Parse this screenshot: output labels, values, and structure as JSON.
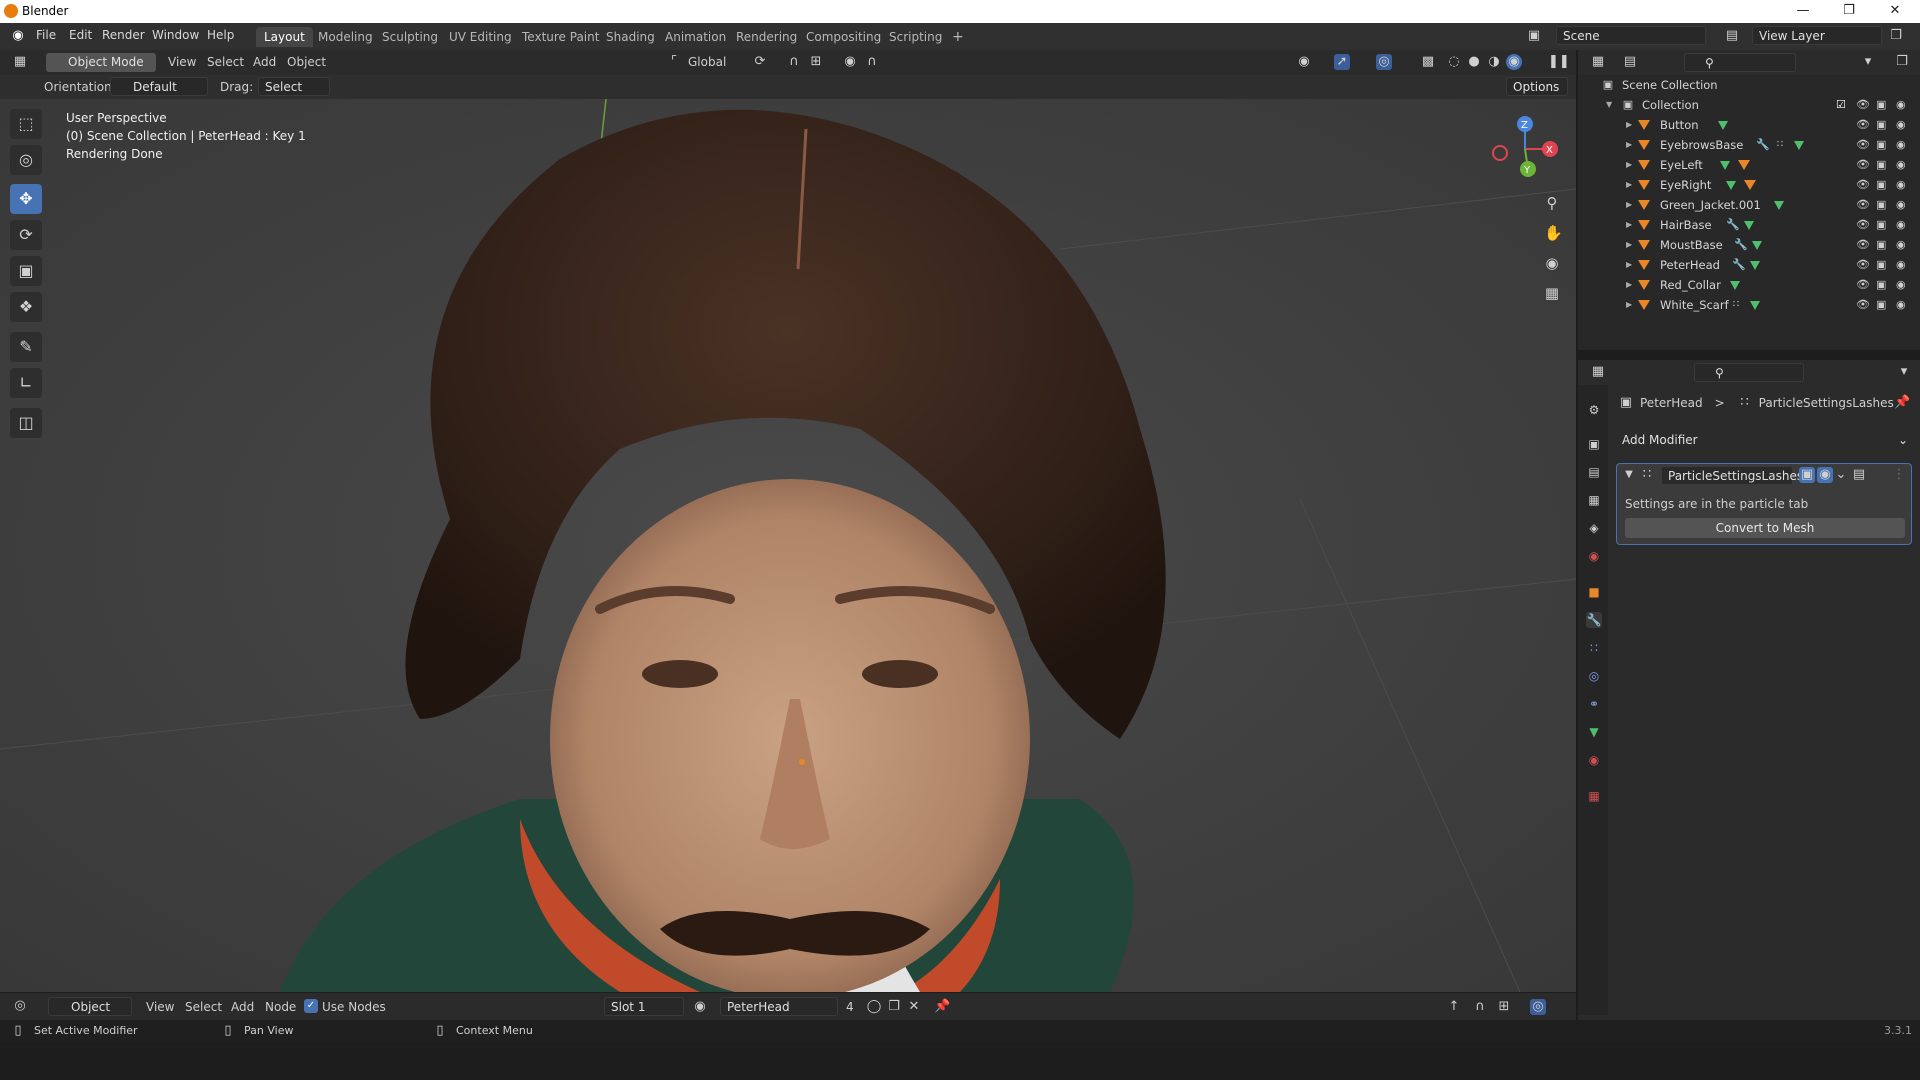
{
  "window": {
    "title": "Blender"
  },
  "menus": [
    "File",
    "Edit",
    "Render",
    "Window",
    "Help"
  ],
  "workspaces": [
    "Layout",
    "Modeling",
    "Sculpting",
    "UV Editing",
    "Texture Paint",
    "Shading",
    "Animation",
    "Rendering",
    "Compositing",
    "Scripting"
  ],
  "workspace_add": "+",
  "scene": {
    "name": "Scene",
    "view_layer": "View Layer"
  },
  "viewport_header": {
    "mode": "Object Mode",
    "menus": [
      "View",
      "Select",
      "Add",
      "Object"
    ],
    "transform": "Global",
    "orientation_label": "Orientation:",
    "orientation_value": "Default",
    "drag_label": "Drag:",
    "drag_value": "Select Box",
    "options": "Options"
  },
  "viewport_overlay": {
    "line1": "User Perspective",
    "line2": "(0) Scene Collection | PeterHead : Key 1",
    "line3": "Rendering Done"
  },
  "gizmo": {
    "z": "Z",
    "x": "X",
    "y": "Y"
  },
  "outliner": {
    "root": "Scene Collection",
    "collection": "Collection",
    "items": [
      {
        "name": "Button"
      },
      {
        "name": "EyebrowsBase"
      },
      {
        "name": "EyeLeft"
      },
      {
        "name": "EyeRight"
      },
      {
        "name": "Green_Jacket.001"
      },
      {
        "name": "HairBase"
      },
      {
        "name": "MoustBase"
      },
      {
        "name": "PeterHead"
      },
      {
        "name": "Red_Collar"
      },
      {
        "name": "White_Scarf"
      }
    ]
  },
  "properties": {
    "breadcrumb_object": "PeterHead",
    "breadcrumb_sep": ">",
    "breadcrumb_modifier": "ParticleSettingsLashes",
    "add_modifier": "Add Modifier",
    "modifier_name": "ParticleSettingsLashes",
    "modifier_note": "Settings are in the particle tab",
    "convert_button": "Convert to Mesh"
  },
  "bottom_header": {
    "editor": "Object",
    "menus": [
      "View",
      "Select",
      "Add",
      "Node"
    ],
    "use_nodes": "Use Nodes",
    "slot": "Slot 1",
    "material": "PeterHead",
    "users": "4"
  },
  "statusbar": {
    "hint1": "Set Active Modifier",
    "hint2": "Pan View",
    "hint3": "Context Menu",
    "version": "3.3.1"
  },
  "colors": {
    "accent": "#4772b3",
    "object": "#e8862a",
    "mesh": "#4ec06c"
  }
}
